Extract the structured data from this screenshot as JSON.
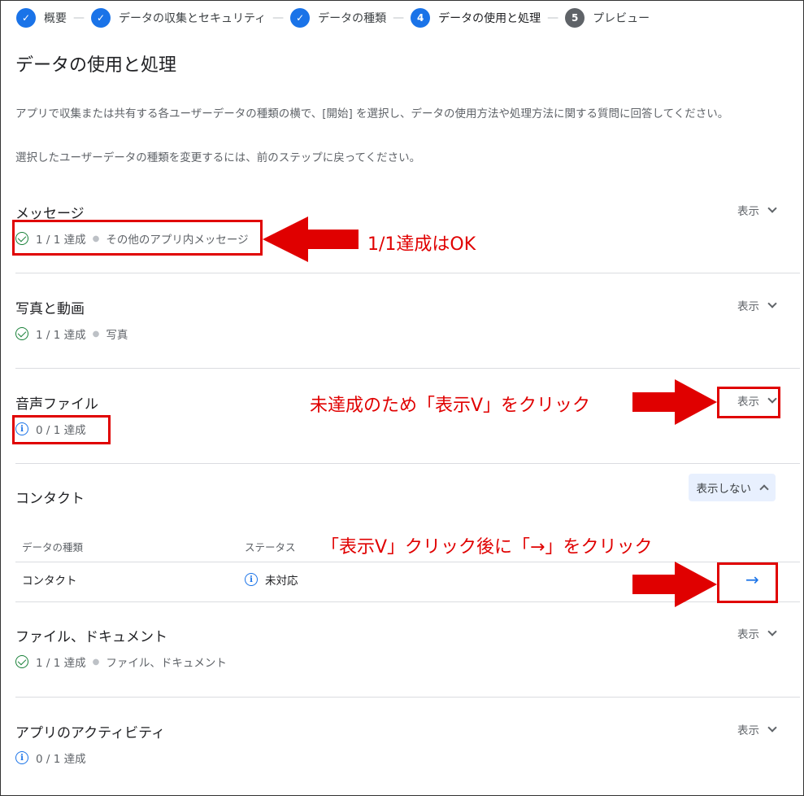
{
  "stepper": [
    {
      "label": "概要",
      "state": "done"
    },
    {
      "label": "データの収集とセキュリティ",
      "state": "done"
    },
    {
      "label": "データの種類",
      "state": "done"
    },
    {
      "label": "データの使用と処理",
      "state": "current",
      "num": "4"
    },
    {
      "label": "プレビュー",
      "state": "pending",
      "num": "5"
    }
  ],
  "page": {
    "title": "データの使用と処理",
    "intro1": "アプリで収集または共有する各ユーザーデータの種類の横で、[開始] を選択し、データの使用方法や処理方法に関する質問に回答してください。",
    "intro2": "選択したユーザーデータの種類を変更するには、前のステップに戻ってください。"
  },
  "sections": [
    {
      "title": "メッセージ",
      "status": "1 / 1 達成",
      "detail": "その他のアプリ内メッセージ",
      "toggle": "表示"
    },
    {
      "title": "写真と動画",
      "status": "1 / 1 達成",
      "detail": "写真",
      "toggle": "表示"
    },
    {
      "title": "音声ファイル",
      "status": "0 / 1 達成",
      "toggle": "表示"
    },
    {
      "title": "コンタクト",
      "toggle": "表示しない"
    },
    {
      "title": "ファイル、ドキュメント",
      "status": "1 / 1 達成",
      "detail": "ファイル、ドキュメント",
      "toggle": "表示"
    },
    {
      "title": "アプリのアクティビティ",
      "status": "0 / 1 達成",
      "toggle": "表示"
    }
  ],
  "contact_table": {
    "col1": "データの種類",
    "col2": "ステータス",
    "row": {
      "type": "コンタクト",
      "status": "未対応",
      "arrow": "→"
    }
  },
  "annotations": {
    "a1": "1/1達成はOK",
    "a2": "未達成のため「表示V」をクリック",
    "a3": "「表示V」クリック後に「→」をクリック"
  },
  "colors": {
    "primary": "#1a73e8",
    "success": "#188038",
    "annotation": "#e00000"
  }
}
